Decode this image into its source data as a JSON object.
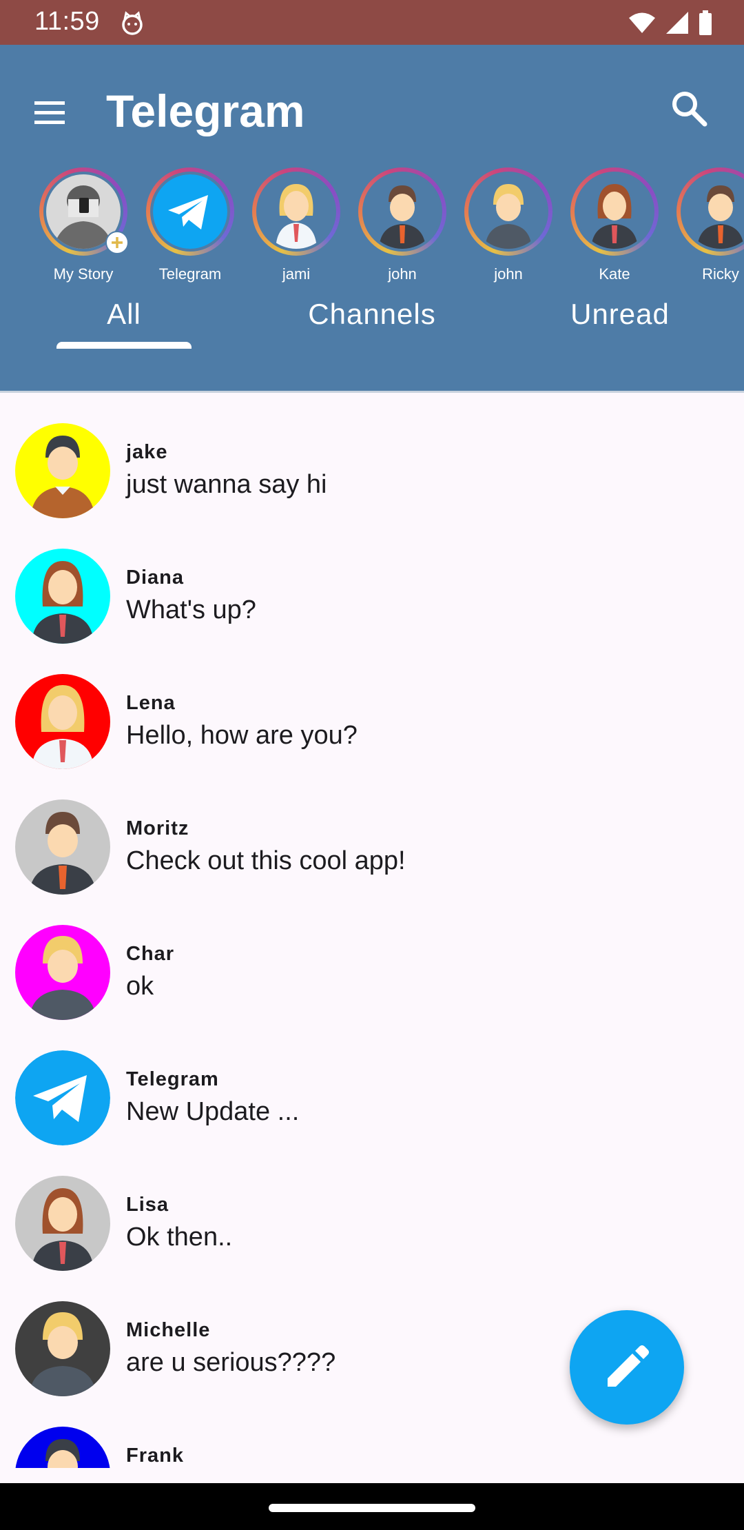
{
  "status_bar": {
    "time": "11:59",
    "icons": [
      "cat-notification-icon",
      "wifi-icon",
      "signal-icon",
      "battery-icon"
    ]
  },
  "header": {
    "title": "Telegram",
    "menu_icon": "hamburger-menu-icon",
    "search_icon": "search-icon",
    "background": "#4E7CA7"
  },
  "stories": [
    {
      "label": "My Story",
      "avatar": "person-with-phone",
      "add_badge": true
    },
    {
      "label": "Telegram",
      "avatar": "telegram-logo"
    },
    {
      "label": "jami",
      "avatar": "woman-blonde-office"
    },
    {
      "label": "john",
      "avatar": "man-brown-suit"
    },
    {
      "label": "john",
      "avatar": "man-blonde"
    },
    {
      "label": "Kate",
      "avatar": "woman-brown-suit"
    },
    {
      "label": "Ricky",
      "avatar": "man-brown-suit"
    }
  ],
  "tabs": [
    {
      "label": "All",
      "selected": true
    },
    {
      "label": "Channels",
      "selected": false
    },
    {
      "label": "Unread",
      "selected": false
    }
  ],
  "chats": [
    {
      "name": "jake",
      "message": "just wanna say hi",
      "avatar_bg": "#FFFF00",
      "avatar": "man-dark-hair-brown-shirt"
    },
    {
      "name": "Diana",
      "message": "What's up?",
      "avatar_bg": "#00FFFF",
      "avatar": "woman-brown-suit"
    },
    {
      "name": "Lena",
      "message": "Hello, how are you?",
      "avatar_bg": "#FF0000",
      "avatar": "woman-blonde-office"
    },
    {
      "name": "Moritz",
      "message": "Check out this cool app!",
      "avatar_bg": "#C8C8C8",
      "avatar": "man-brown-suit"
    },
    {
      "name": "Char",
      "message": "ok",
      "avatar_bg": "#FF00FF",
      "avatar": "man-blonde"
    },
    {
      "name": "Telegram",
      "message": "New Update ...",
      "avatar_bg": "#0EA5F2",
      "avatar": "telegram-logo"
    },
    {
      "name": "Lisa",
      "message": "Ok then..",
      "avatar_bg": "#C8C8C8",
      "avatar": "woman-brown-suit"
    },
    {
      "name": "Michelle",
      "message": "are u serious????",
      "avatar_bg": "#404040",
      "avatar": "man-blonde"
    },
    {
      "name": "Frank",
      "message": "",
      "avatar_bg": "#0000EE",
      "avatar": "man-dark-hair"
    }
  ],
  "fab": {
    "icon": "pencil-edit-icon",
    "color": "#0EA5F2"
  }
}
